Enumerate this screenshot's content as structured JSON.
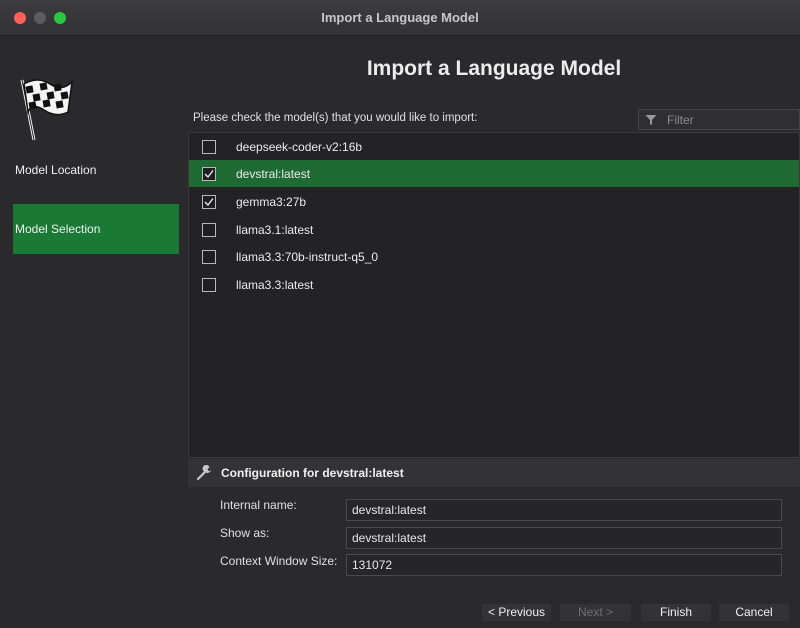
{
  "window": {
    "title": "Import a Language Model"
  },
  "sidebar": {
    "items": [
      {
        "label": "Model Location",
        "selected": false
      },
      {
        "label": "Model Selection",
        "selected": true
      }
    ]
  },
  "heading": "Import a Language Model",
  "prompt": "Please check the model(s) that you would like to import:",
  "filter": {
    "placeholder": "Filter",
    "value": ""
  },
  "models": [
    {
      "label": "deepseek-coder-v2:16b",
      "checked": false,
      "selected": false
    },
    {
      "label": "devstral:latest",
      "checked": true,
      "selected": true
    },
    {
      "label": "gemma3:27b",
      "checked": true,
      "selected": false
    },
    {
      "label": "llama3.1:latest",
      "checked": false,
      "selected": false
    },
    {
      "label": "llama3.3:70b-instruct-q5_0",
      "checked": false,
      "selected": false
    },
    {
      "label": "llama3.3:latest",
      "checked": false,
      "selected": false
    }
  ],
  "config": {
    "title": "Configuration for devstral:latest",
    "internal_name_label": "Internal name:",
    "internal_name_value": "devstral:latest",
    "show_as_label": "Show as:",
    "show_as_value": "devstral:latest",
    "context_label": "Context Window Size:",
    "context_value": "131072"
  },
  "buttons": {
    "previous": "< Previous",
    "next": "Next >",
    "finish": "Finish",
    "cancel": "Cancel"
  },
  "colors": {
    "accent": "#1a7a35",
    "selected_row": "#1f6a33"
  },
  "icons": [
    "checkered-flag-icon",
    "filter-icon",
    "wrench-icon",
    "checkmark-icon"
  ]
}
